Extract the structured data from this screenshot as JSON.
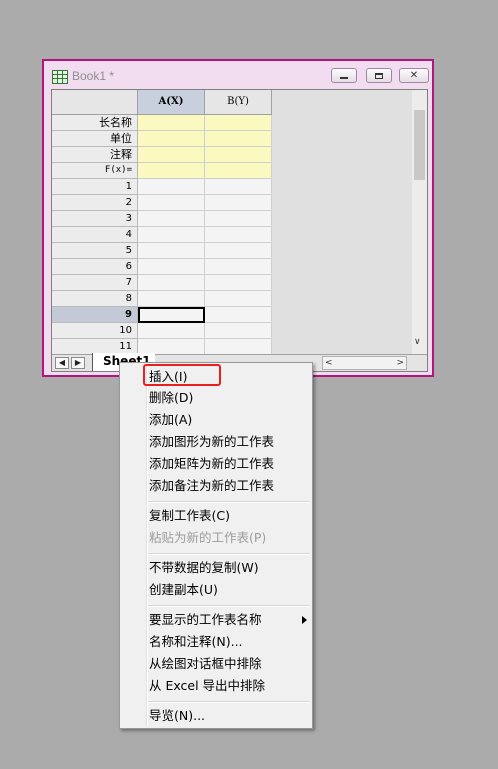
{
  "window": {
    "title": "Book1 *"
  },
  "worksheet": {
    "col_a": "A(X)",
    "col_b": "B(Y)",
    "meta_rows": [
      "长名称",
      "单位",
      "注释",
      "F(x)="
    ],
    "data_rows": [
      "1",
      "2",
      "3",
      "4",
      "5",
      "6",
      "7",
      "8",
      "9",
      "10",
      "11"
    ],
    "selected_row": "9",
    "sheet_tab": "Sheet1"
  },
  "menu": {
    "items": [
      "插入(I)",
      "删除(D)",
      "添加(A)",
      "添加图形为新的工作表",
      "添加矩阵为新的工作表",
      "添加备注为新的工作表",
      "复制工作表(C)",
      "粘贴为新的工作表(P)",
      "不带数据的复制(W)",
      "创建副本(U)",
      "要显示的工作表名称",
      "名称和注释(N)...",
      "从绘图对话框中排除",
      "从 Excel 导出中排除",
      "导览(N)..."
    ]
  },
  "colors": {
    "highlight": "#e8201f",
    "window_border": "#b2157e",
    "meta_cell": "#fafac0"
  }
}
